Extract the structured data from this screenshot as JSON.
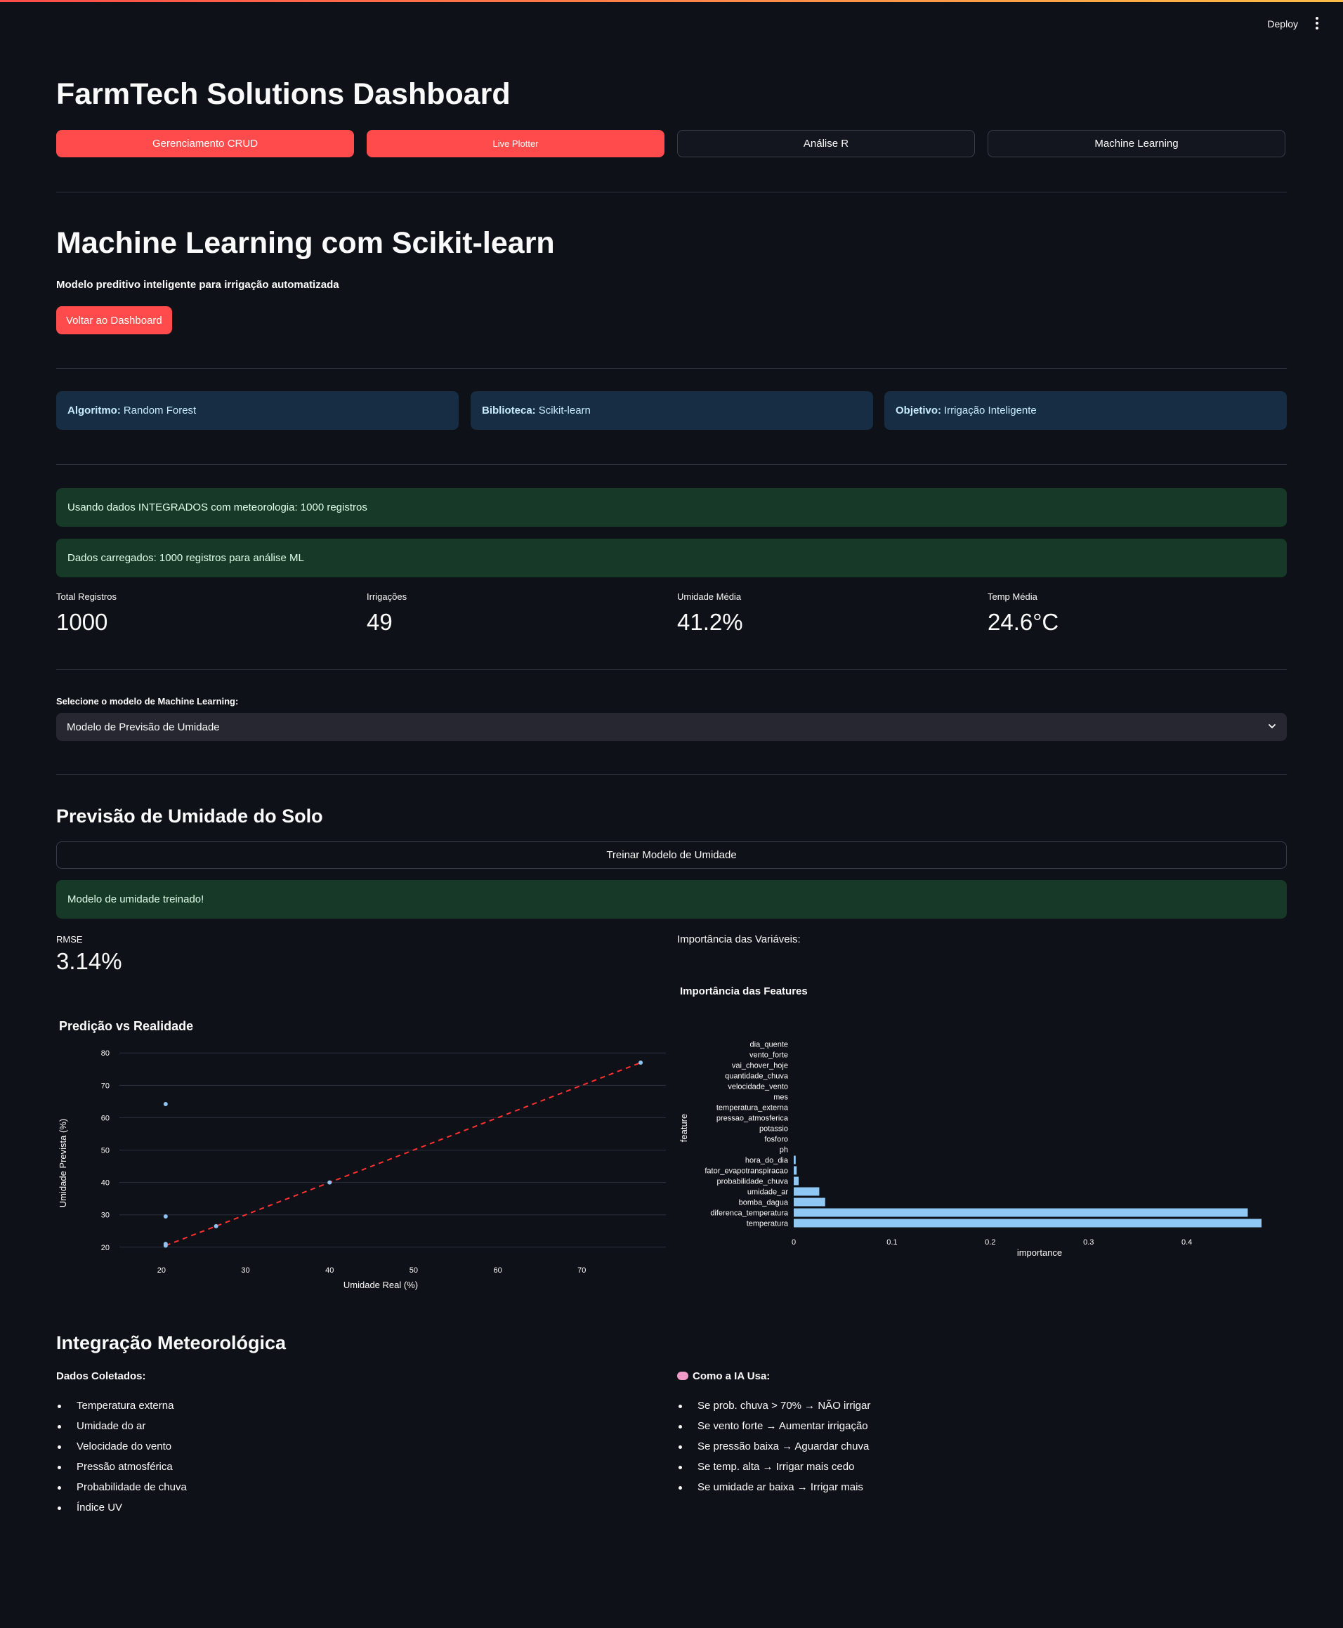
{
  "header": {
    "deploy_label": "Deploy",
    "menu_icon": "more-vertical-icon"
  },
  "app": {
    "title": "FarmTech Solutions Dashboard"
  },
  "nav": {
    "buttons": [
      {
        "label": "Gerenciamento CRUD"
      },
      {
        "label": "Live Plotter"
      },
      {
        "label": "Análise R"
      },
      {
        "label": "Machine Learning"
      }
    ]
  },
  "ml": {
    "title": "Machine Learning com Scikit-learn",
    "subtitle": "Modelo preditivo inteligente para irrigação automatizada",
    "back_label": "Voltar ao Dashboard",
    "info": [
      {
        "key": "Algoritmo:",
        "value": "Random Forest"
      },
      {
        "key": "Biblioteca:",
        "value": "Scikit-learn"
      },
      {
        "key": "Objetivo:",
        "value": "Irrigação Inteligente"
      }
    ],
    "success_integrated": "Usando dados INTEGRADOS com meteorologia: 1000 registros",
    "success_loaded": "Dados carregados: 1000 registros para análise ML",
    "metrics": [
      {
        "label": "Total Registros",
        "value": "1000"
      },
      {
        "label": "Irrigações",
        "value": "49"
      },
      {
        "label": "Umidade Média",
        "value": "41.2%"
      },
      {
        "label": "Temp Média",
        "value": "24.6°C"
      }
    ],
    "select_label": "Selecione o modelo de Machine Learning:",
    "select_value": "Modelo de Previsão de Umidade"
  },
  "humidity": {
    "title": "Previsão de Umidade do Solo",
    "train_label": "Treinar Modelo de Umidade",
    "trained_msg": "Modelo de umidade treinado!",
    "rmse_label": "RMSE",
    "rmse_value": "3.14%",
    "importance_label": "Importância das Variáveis:"
  },
  "chart_data": [
    {
      "type": "scatter",
      "title": "Predição vs Realidade",
      "xlabel": "Umidade Real (%)",
      "ylabel": "Umidade Prevista (%)",
      "xlim": [
        15,
        80
      ],
      "ylim": [
        18,
        82
      ],
      "xticks": [
        20,
        30,
        40,
        50,
        60,
        70
      ],
      "yticks": [
        20,
        30,
        40,
        50,
        60,
        70,
        80
      ],
      "points": [
        {
          "x": 20.5,
          "y": 64.2
        },
        {
          "x": 20.5,
          "y": 29.5
        },
        {
          "x": 20.5,
          "y": 21.0
        },
        {
          "x": 20.5,
          "y": 20.5
        },
        {
          "x": 26.5,
          "y": 26.5
        },
        {
          "x": 40.0,
          "y": 40.0
        },
        {
          "x": 77.0,
          "y": 77.0
        }
      ],
      "reference_line": {
        "from": [
          20.5,
          20.5
        ],
        "to": [
          77.0,
          77.0
        ],
        "color": "#ff3030",
        "style": "dashed"
      },
      "point_color": "#8fc3f2",
      "grid": true
    },
    {
      "type": "bar",
      "orientation": "horizontal",
      "title": "Importância das Features",
      "xlabel": "importance",
      "ylabel": "feature",
      "xlim": [
        0,
        0.476
      ],
      "xticks": [
        0,
        0.1,
        0.2,
        0.3,
        0.4
      ],
      "categories": [
        "dia_quente",
        "vento_forte",
        "vai_chover_hoje",
        "quantidade_chuva",
        "velocidade_vento",
        "mes",
        "temperatura_externa",
        "pressao_atmosferica",
        "potassio",
        "fosforo",
        "ph",
        "hora_do_dia",
        "fator_evapotranspiracao",
        "probabilidade_chuva",
        "umidade_ar",
        "bomba_dagua",
        "diferenca_temperatura",
        "temperatura"
      ],
      "values": [
        0,
        0,
        0,
        0,
        0,
        0,
        0,
        0,
        0,
        0,
        0,
        0.002,
        0.003,
        0.005,
        0.026,
        0.032,
        0.462,
        0.476
      ],
      "bar_color": "#8fc8f5"
    }
  ],
  "integration": {
    "title": "Integração Meteorológica",
    "collected_title": "Dados Coletados:",
    "collected": [
      "Temperatura externa",
      "Umidade do ar",
      "Velocidade do vento",
      "Pressão atmosférica",
      "Probabilidade de chuva",
      "Índice UV"
    ],
    "ai_title": "Como a IA Usa:",
    "ai_icon": "brain-icon",
    "ai_rules": [
      "Se prob. chuva > 70% → NÃO irrigar",
      "Se vento forte → Aumentar irrigação",
      "Se pressão baixa → Aguardar chuva",
      "Se temp. alta → Irrigar mais cedo",
      "Se umidade ar baixa → Irrigar mais"
    ]
  }
}
